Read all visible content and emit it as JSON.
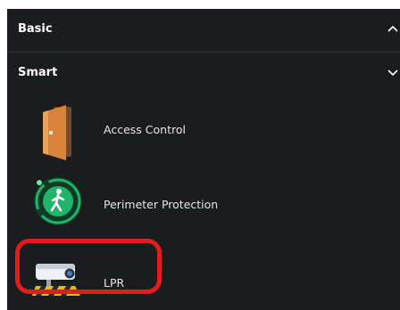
{
  "sections": {
    "basic": {
      "label": "Basic",
      "expanded": false,
      "chevron_icon": "chevron-up-icon"
    },
    "smart": {
      "label": "Smart",
      "expanded": true,
      "chevron_icon": "chevron-down-icon"
    }
  },
  "smart_items": [
    {
      "label": "Access Control",
      "icon": "door-icon"
    },
    {
      "label": "Perimeter Protection",
      "icon": "perimeter-walker-icon"
    },
    {
      "label": "LPR",
      "icon": "lpr-camera-icon"
    }
  ],
  "colors": {
    "panel_background": "#1b1c1f",
    "highlight_border": "#e11d1d",
    "door_orange": "#d9843b",
    "perimeter_green": "#22b36a"
  }
}
